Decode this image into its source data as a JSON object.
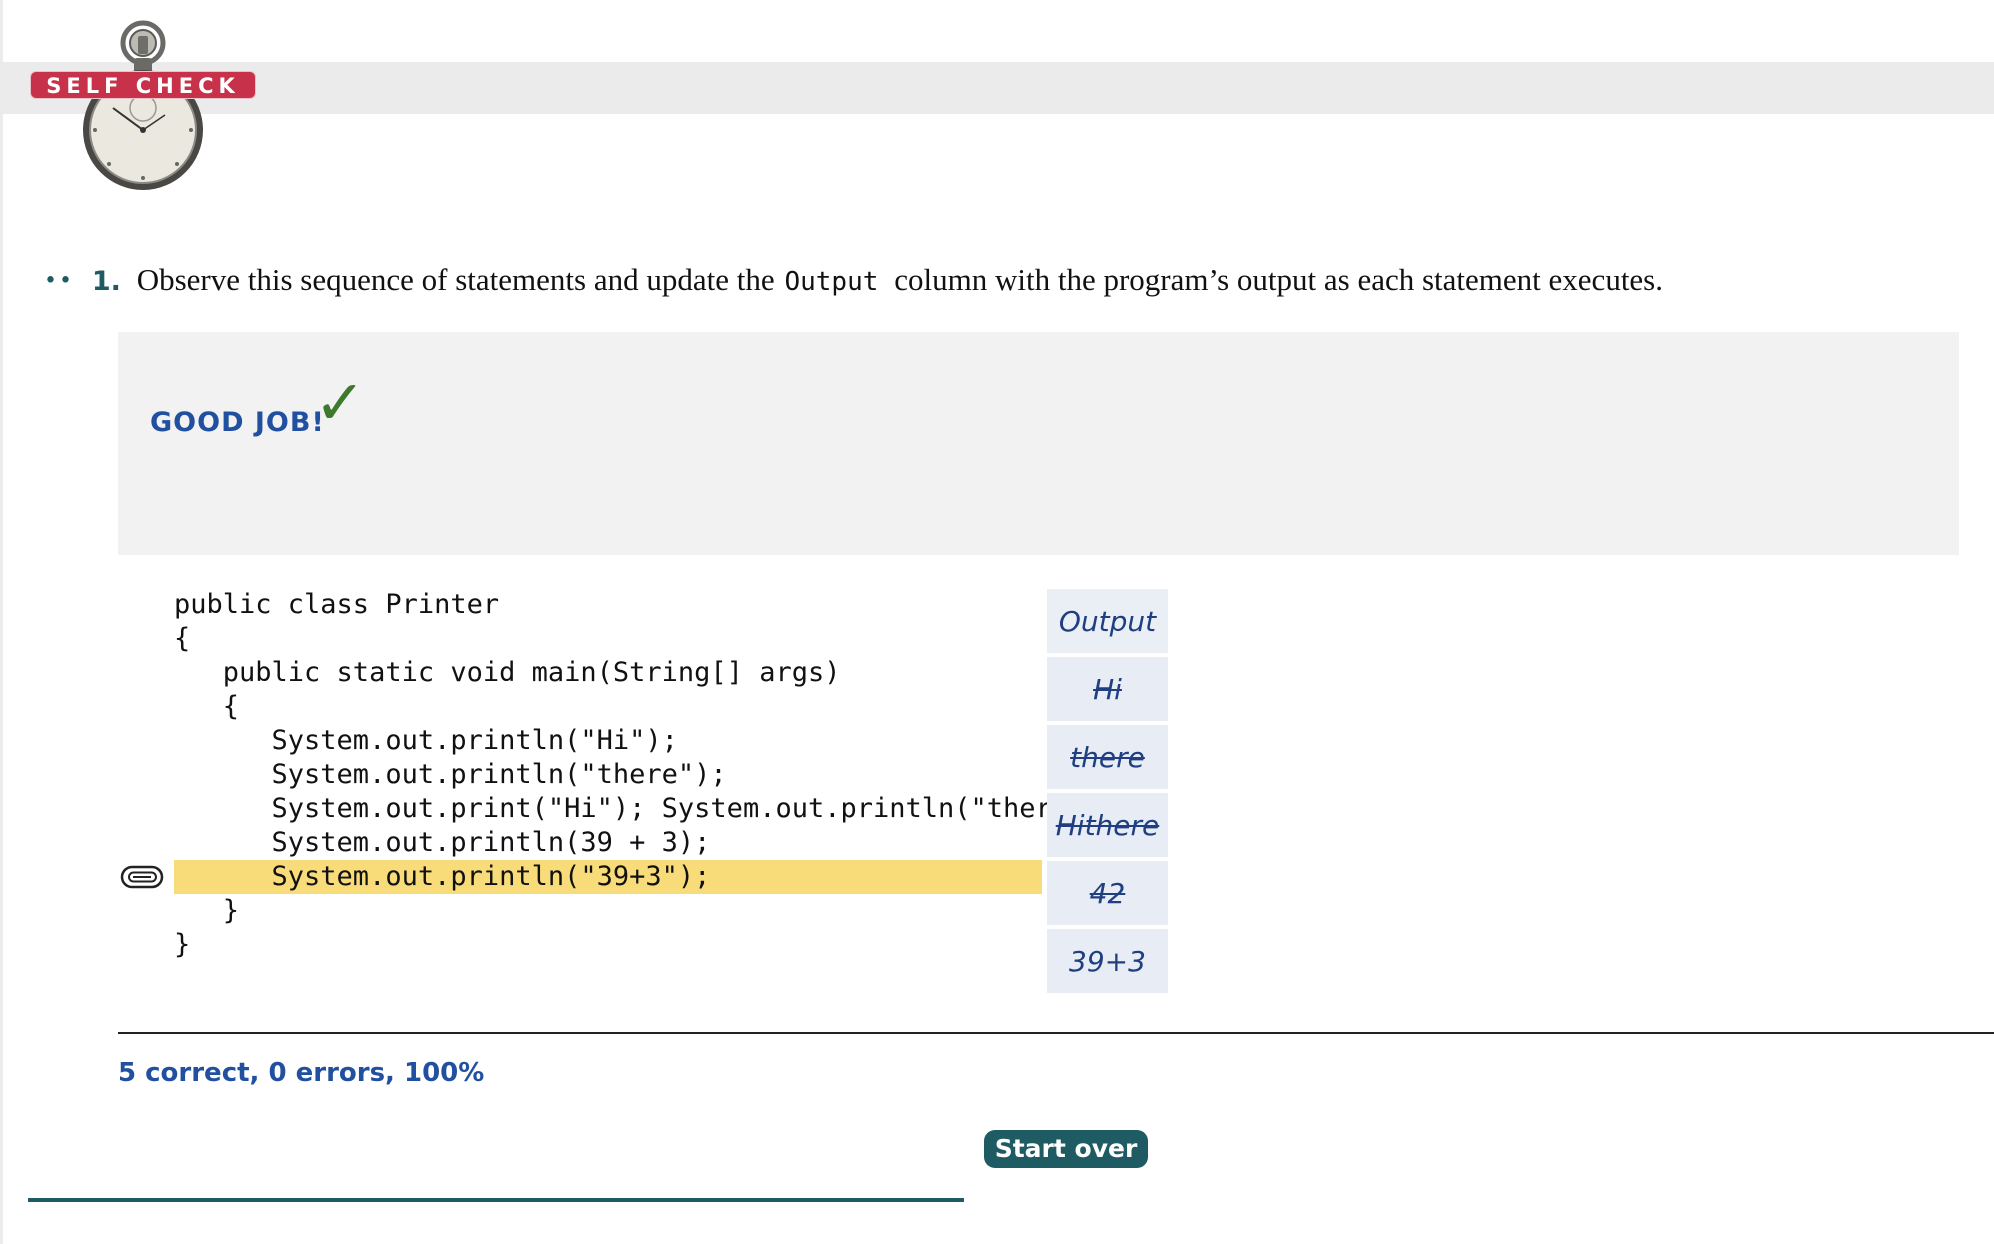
{
  "header": {
    "badge_label": "SELF CHECK"
  },
  "question": {
    "dots": "••",
    "number": "1.",
    "text_before": "Observe this sequence of statements and update the",
    "code_word": "Output",
    "text_after": "column with the program’s output as each statement executes."
  },
  "feedback": {
    "message": "GOOD JOB!",
    "check": "✓"
  },
  "code": {
    "lines": [
      "public class Printer",
      "{",
      "   public static void main(String[] args)",
      "   {",
      "      System.out.println(\"Hi\");",
      "      System.out.println(\"there\");",
      "      System.out.print(\"Hi\"); System.out.println(\"there\");",
      "      System.out.println(39 + 3);",
      "      System.out.println(\"39+3\");",
      "   }",
      "}"
    ],
    "highlighted_line_index": 8
  },
  "output": {
    "header": "Output",
    "entries": [
      "Hi",
      "there",
      "Hithere",
      "42",
      "39+3"
    ],
    "struck_out_count": 4
  },
  "status": {
    "summary": "5 correct, 0 errors, 100%"
  },
  "actions": {
    "start_over_label": "Start over"
  },
  "colors": {
    "badge": "#c8314a",
    "teal": "#1f5b62",
    "highlight": "#f8dc7a",
    "blue_text": "#2150a0",
    "check_green": "#3d7a2e",
    "output_cell": "#e7ecf5"
  }
}
